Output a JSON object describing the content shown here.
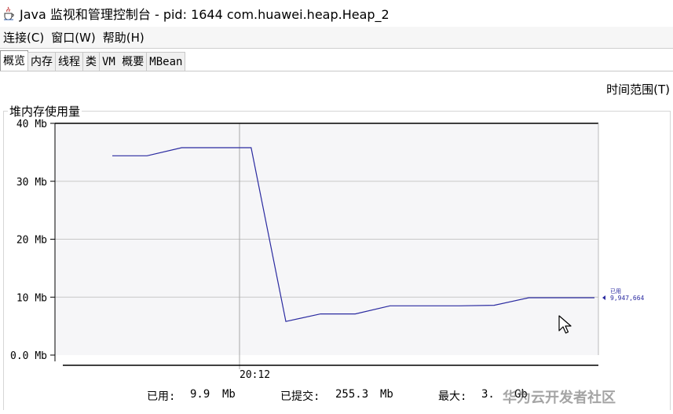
{
  "window": {
    "title": "Java 监视和管理控制台 - pid: 1644 com.huawei.heap.Heap_2",
    "icon": "java-coffee-icon"
  },
  "menu": [
    {
      "label": "连接(C)"
    },
    {
      "label": "窗口(W)"
    },
    {
      "label": "帮助(H)"
    }
  ],
  "tabs": [
    {
      "label": "概览",
      "active": true
    },
    {
      "label": "内存",
      "active": false
    },
    {
      "label": "线程",
      "active": false
    },
    {
      "label": "类",
      "active": false
    },
    {
      "label": "VM 概要",
      "active": false
    },
    {
      "label": "MBean",
      "active": false
    }
  ],
  "time_range_label": "时间范围(T)",
  "panel": {
    "title": "堆内存使用量"
  },
  "colors": {
    "series": "#2a2aa0",
    "grid": "#c8c8c8",
    "plot_bg": "#f6f6f8"
  },
  "chart_data": {
    "type": "line",
    "yticks": [
      "40 Mb",
      "30 Mb",
      "20 Mb",
      "10 Mb",
      "0.0 Mb"
    ],
    "xticks": [
      "20:12"
    ],
    "ylim": [
      0,
      40
    ],
    "ylabel_unit": "Mb",
    "grid": true,
    "series": [
      {
        "name": "已用",
        "current_value_label": "9,947,664",
        "points": [
          {
            "i": 0,
            "v": 34.4
          },
          {
            "i": 1,
            "v": 34.4
          },
          {
            "i": 2,
            "v": 35.8
          },
          {
            "i": 3,
            "v": 35.8
          },
          {
            "i": 4,
            "v": 35.8
          },
          {
            "i": 5,
            "v": 5.8
          },
          {
            "i": 6,
            "v": 7.1
          },
          {
            "i": 7,
            "v": 7.1
          },
          {
            "i": 8,
            "v": 8.5
          },
          {
            "i": 9,
            "v": 8.5
          },
          {
            "i": 10,
            "v": 8.5
          },
          {
            "i": 11,
            "v": 8.6
          },
          {
            "i": 12,
            "v": 9.9
          },
          {
            "i": 13,
            "v": 9.9
          }
        ]
      }
    ]
  },
  "footer": {
    "used_label": "已用:",
    "used_value": "9.9",
    "used_unit": "Mb",
    "committed_label": "已提交:",
    "committed_value": "255.3",
    "committed_unit": "Mb",
    "max_label": "最大:",
    "max_value": "3.",
    "max_unit": "Gb"
  },
  "watermark": "华为云开发者社区"
}
